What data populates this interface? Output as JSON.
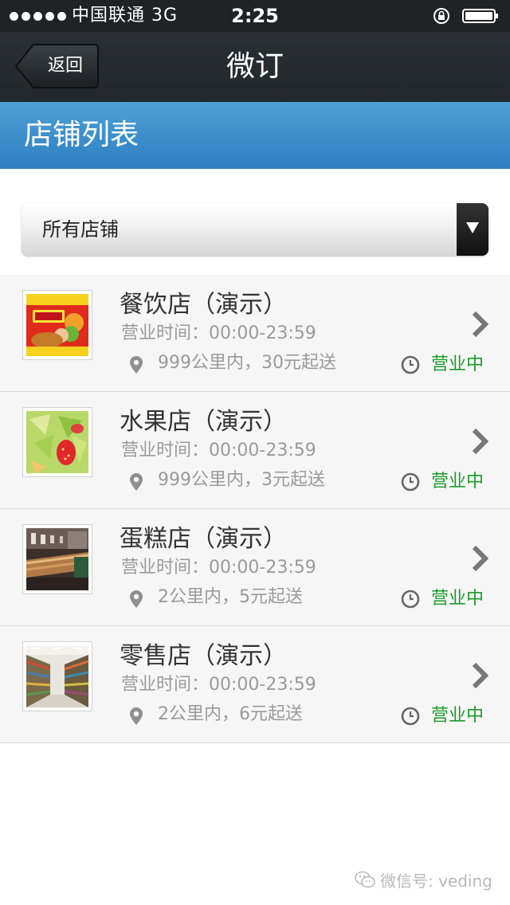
{
  "status_bar": {
    "carrier": "中国联通 3G",
    "time": "2:25"
  },
  "nav": {
    "back_label": "返回",
    "title": "微订"
  },
  "section": {
    "title": "店铺列表"
  },
  "filter": {
    "selected": "所有店铺"
  },
  "stores": [
    {
      "name": "餐饮店（演示）",
      "hours": "营业时间：00:00-23:59",
      "delivery": "999公里内，30元起送",
      "status": "营业中",
      "thumb_icon": "restaurant-food-image"
    },
    {
      "name": "水果店（演示）",
      "hours": "营业时间：00:00-23:59",
      "delivery": "999公里内，3元起送",
      "status": "营业中",
      "thumb_icon": "fruit-salad-image"
    },
    {
      "name": "蛋糕店（演示）",
      "hours": "营业时间：00:00-23:59",
      "delivery": "2公里内，5元起送",
      "status": "营业中",
      "thumb_icon": "bakery-shop-image"
    },
    {
      "name": "零售店（演示）",
      "hours": "营业时间：00:00-23:59",
      "delivery": "2公里内，6元起送",
      "status": "营业中",
      "thumb_icon": "supermarket-aisle-image"
    }
  ],
  "watermark": {
    "text": "微信号: veding"
  },
  "colors": {
    "nav_background": "#22272a",
    "section_header": "#3a8fce",
    "status_open": "#1c9a2b",
    "secondary_text": "#9a9a9a"
  }
}
